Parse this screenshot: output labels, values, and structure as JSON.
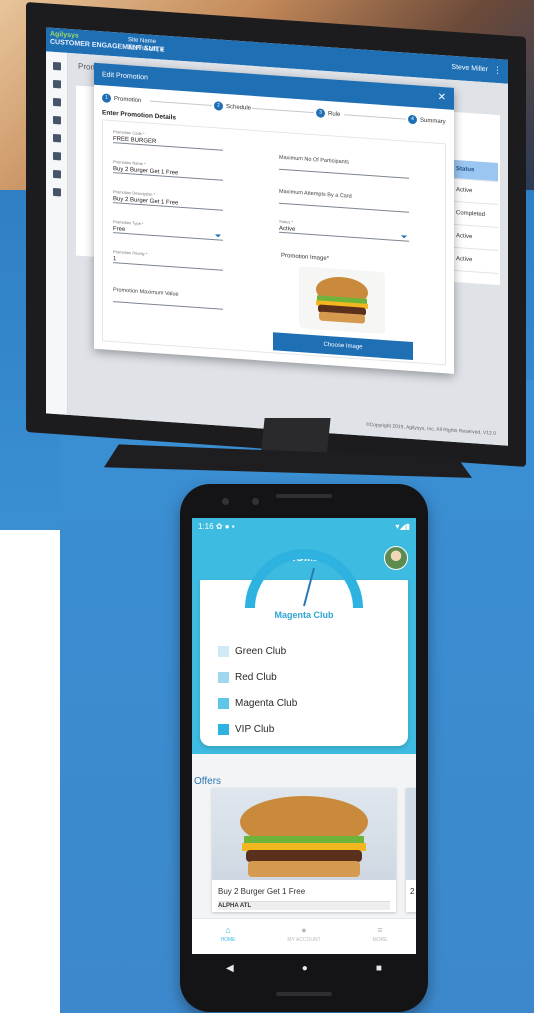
{
  "desktop": {
    "brand_line1": "Agilysys",
    "brand_line2": "CUSTOMER ENGAGEMENT SUITE",
    "site_label": "Site Name",
    "site_value": "ALPHA ATL",
    "user": "Steve Miller",
    "page_tab": "Promo",
    "status_header": "Status",
    "status_rows": [
      "Active",
      "Completed",
      "Active",
      "Active"
    ],
    "copyright": "©Copyright 2019, Agilysys, Inc. All Rights Reserved. V12.0",
    "modal": {
      "title": "Edit Promotion",
      "steps": [
        {
          "num": "1",
          "label": "Promotion"
        },
        {
          "num": "2",
          "label": "Schedule"
        },
        {
          "num": "3",
          "label": "Rule"
        },
        {
          "num": "4",
          "label": "Summary"
        }
      ],
      "section_title": "Enter Promotion Details",
      "fields": {
        "name_label": "Promotion Code *",
        "name_value": "FREE BURGER",
        "pname_label": "Promotion Name *",
        "pname_value": "Buy 2 Burger Get 1 Free",
        "desc_label": "Promotion Description *",
        "desc_value": "Buy 2 Burger Get 1 Free",
        "type_label": "Promotion Type *",
        "type_value": "Free",
        "priority_label": "Promotion Priority *",
        "priority_value": "1",
        "max_value_label": "Promotion Maximum Value",
        "max_participants_label": "Maximum No Of Participants",
        "max_attempts_label": "Maximum Attempts By a Card",
        "status_label": "Status *",
        "status_value": "Active"
      },
      "image_label": "Promotion Image*",
      "choose_button": "Choose Image"
    }
  },
  "phone": {
    "time": "1:16",
    "title": "HOME",
    "tier": "Magenta Club",
    "clubs": [
      {
        "label": "Green Club",
        "color": "#cfeaf6"
      },
      {
        "label": "Red Club",
        "color": "#9fd8ee"
      },
      {
        "label": "Magenta Club",
        "color": "#5ec7e8"
      },
      {
        "label": "VIP Club",
        "color": "#2eb3e0"
      }
    ],
    "offers_label": "Offers",
    "offer": {
      "name": "Buy 2 Burger Get 1 Free",
      "location": "ALPHA ATL"
    },
    "offer2_name": "2",
    "nav": {
      "home": "HOME",
      "account": "MY ACCOUNT",
      "more": "MORE"
    }
  }
}
